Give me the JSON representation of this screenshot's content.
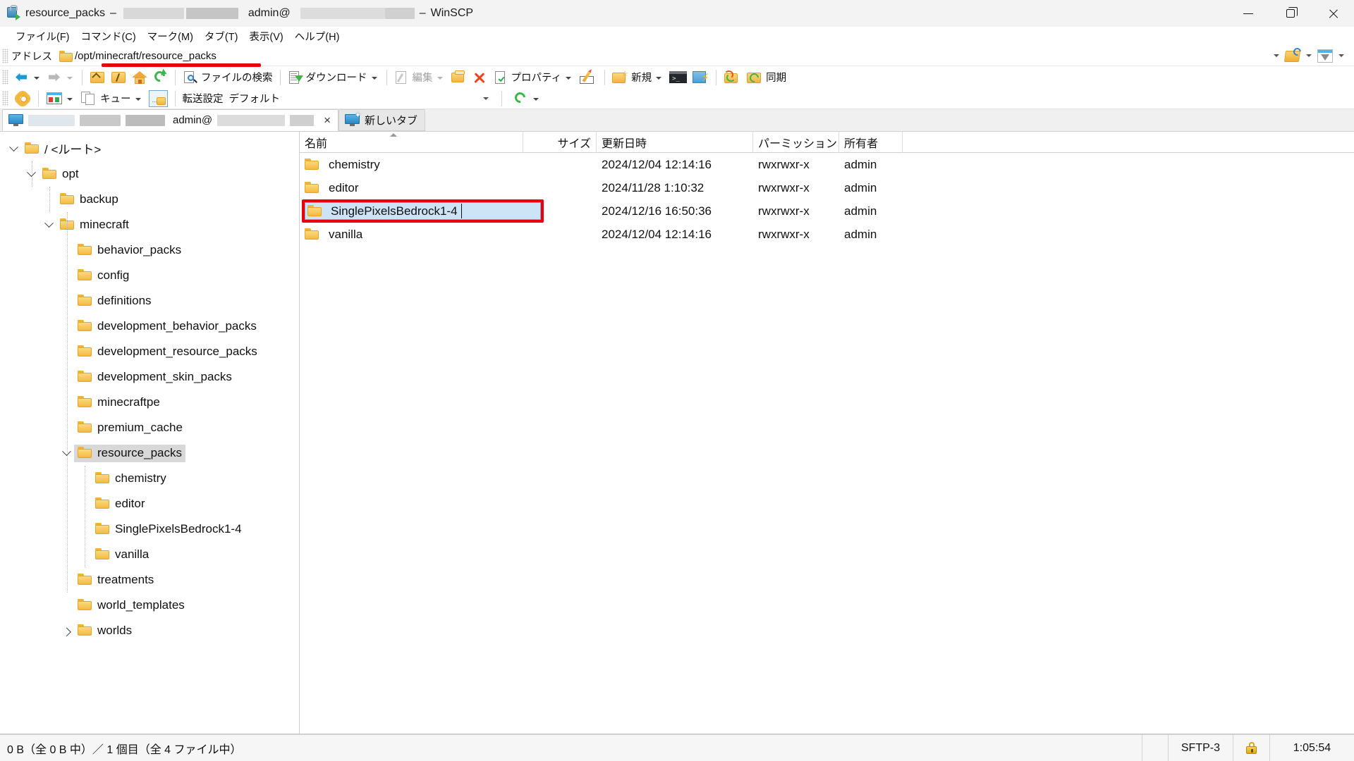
{
  "window": {
    "title_prefix": "resource_packs",
    "title_user": "admin@",
    "app_name": "WinSCP",
    "dash": "–",
    "icon": "winscp-lock-icon"
  },
  "window_controls": {
    "minimize": "minimize-button",
    "maximize": "restore-button",
    "close": "close-button"
  },
  "menubar": {
    "items": [
      {
        "label": "ファイル(F)",
        "name": "menu-file"
      },
      {
        "label": "コマンド(C)",
        "name": "menu-command"
      },
      {
        "label": "マーク(M)",
        "name": "menu-mark"
      },
      {
        "label": "タブ(T)",
        "name": "menu-tab"
      },
      {
        "label": "表示(V)",
        "name": "menu-view"
      },
      {
        "label": "ヘルプ(H)",
        "name": "menu-help"
      }
    ]
  },
  "address": {
    "label": "アドレス",
    "path": "/opt/minecraft/resource_packs",
    "annotated": true,
    "annotation_color": "#e8000d"
  },
  "toolbar": {
    "back": "戻る",
    "forward": "進む",
    "parent": "親ディレクトリ",
    "root": "ルート",
    "home": "ホーム",
    "refresh": "更新",
    "find_files": "ファイルの検索",
    "download": "ダウンロード",
    "edit": "編集",
    "duplicate": "複製",
    "delete": "削除",
    "properties": "プロパティ",
    "rename": "名前の変更",
    "new": "新規",
    "terminal": "コンソール",
    "command": "コマンド実行",
    "sync_browse": "同期ブラウズ",
    "sync": "同期"
  },
  "toolbar2": {
    "preferences": "設定",
    "panels": "パネル表示",
    "queue": "キュー",
    "transfer_settings_toggle": "転送設定切替",
    "transfer_settings_label": "転送設定",
    "transfer_settings_value": "デフォルト",
    "refresh": "更新"
  },
  "tabs": {
    "active": {
      "user": "admin@",
      "close": "×"
    },
    "new_tab": {
      "label": "新しいタブ"
    }
  },
  "tree": {
    "items": [
      {
        "label": "/ <ルート>",
        "depth": 0,
        "twisty": "expanded",
        "selected": false
      },
      {
        "label": "opt",
        "depth": 1,
        "twisty": "expanded",
        "selected": false
      },
      {
        "label": "backup",
        "depth": 2,
        "twisty": "none",
        "selected": false
      },
      {
        "label": "minecraft",
        "depth": 2,
        "twisty": "expanded",
        "selected": false
      },
      {
        "label": "behavior_packs",
        "depth": 3,
        "twisty": "none",
        "selected": false
      },
      {
        "label": "config",
        "depth": 3,
        "twisty": "none",
        "selected": false
      },
      {
        "label": "definitions",
        "depth": 3,
        "twisty": "none",
        "selected": false
      },
      {
        "label": "development_behavior_packs",
        "depth": 3,
        "twisty": "none",
        "selected": false
      },
      {
        "label": "development_resource_packs",
        "depth": 3,
        "twisty": "none",
        "selected": false
      },
      {
        "label": "development_skin_packs",
        "depth": 3,
        "twisty": "none",
        "selected": false
      },
      {
        "label": "minecraftpe",
        "depth": 3,
        "twisty": "none",
        "selected": false
      },
      {
        "label": "premium_cache",
        "depth": 3,
        "twisty": "none",
        "selected": false
      },
      {
        "label": "resource_packs",
        "depth": 3,
        "twisty": "expanded",
        "selected": true
      },
      {
        "label": "chemistry",
        "depth": 4,
        "twisty": "none",
        "selected": false
      },
      {
        "label": "editor",
        "depth": 4,
        "twisty": "none",
        "selected": false
      },
      {
        "label": "SinglePixelsBedrock1-4",
        "depth": 4,
        "twisty": "none",
        "selected": false
      },
      {
        "label": "vanilla",
        "depth": 4,
        "twisty": "none",
        "selected": false
      },
      {
        "label": "treatments",
        "depth": 3,
        "twisty": "none",
        "selected": false
      },
      {
        "label": "world_templates",
        "depth": 3,
        "twisty": "none",
        "selected": false
      },
      {
        "label": "worlds",
        "depth": 3,
        "twisty": "collapsed",
        "selected": false
      }
    ]
  },
  "filelist": {
    "columns": [
      {
        "key": "name",
        "label": "名前",
        "align": "left",
        "sorted": "asc"
      },
      {
        "key": "size",
        "label": "サイズ",
        "align": "right",
        "sorted": ""
      },
      {
        "key": "date",
        "label": "更新日時",
        "align": "left",
        "sorted": ""
      },
      {
        "key": "perm",
        "label": "パーミッション",
        "align": "left",
        "sorted": ""
      },
      {
        "key": "owner",
        "label": "所有者",
        "align": "left",
        "sorted": ""
      }
    ],
    "rows": [
      {
        "name": "chemistry",
        "size": "",
        "date": "2024/12/04 12:14:16",
        "perm": "rwxrwxr-x",
        "owner": "admin",
        "editing": false
      },
      {
        "name": "editor",
        "size": "",
        "date": "2024/11/28 1:10:32",
        "perm": "rwxrwxr-x",
        "owner": "admin",
        "editing": false
      },
      {
        "name": "SinglePixelsBedrock1-4",
        "size": "",
        "date": "2024/12/16 16:50:36",
        "perm": "rwxrwxr-x",
        "owner": "admin",
        "editing": true
      },
      {
        "name": "vanilla",
        "size": "",
        "date": "2024/12/04 12:14:16",
        "perm": "rwxrwxr-x",
        "owner": "admin",
        "editing": false
      }
    ],
    "edit_value": "SinglePixelsBedrock1-4"
  },
  "statusbar": {
    "summary": "0 B（全 0 B 中）／ 1 個目（全 4 ファイル中）",
    "protocol": "SFTP-3",
    "secure_icon": "lock-icon",
    "elapsed": "1:05:54"
  }
}
